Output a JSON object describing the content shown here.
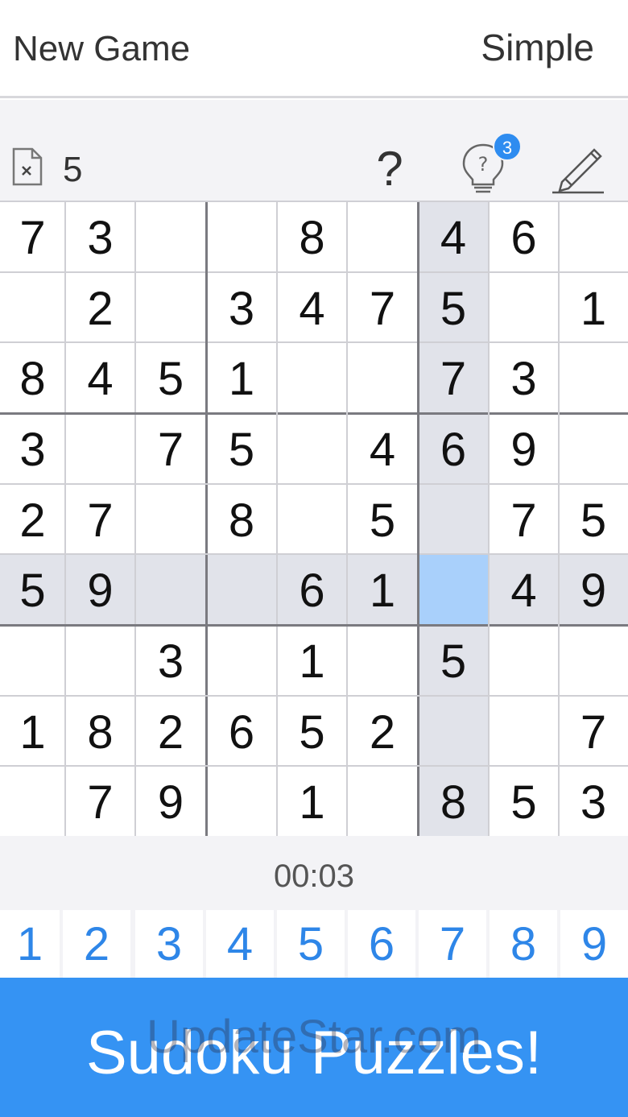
{
  "header": {
    "new_game_label": "New Game",
    "difficulty_label": "Simple"
  },
  "toolbar": {
    "mistakes_icon": "file-x-icon",
    "mistakes_count": "5",
    "help_label": "?",
    "hint_icon": "lightbulb-icon",
    "hint_badge": "3",
    "pencil_icon": "pencil-icon"
  },
  "board": {
    "rows": [
      [
        "7",
        "3",
        "",
        "",
        "8",
        "",
        "4",
        "6",
        ""
      ],
      [
        "",
        "2",
        "",
        "3",
        "4",
        "7",
        "5",
        "",
        "1"
      ],
      [
        "8",
        "4",
        "5",
        "1",
        "",
        "",
        "7",
        "3",
        ""
      ],
      [
        "3",
        "",
        "7",
        "5",
        "",
        "4",
        "6",
        "9",
        ""
      ],
      [
        "2",
        "7",
        "",
        "8",
        "",
        "5",
        "",
        "7",
        "5"
      ],
      [
        "5",
        "9",
        "",
        "",
        "6",
        "1",
        "",
        "4",
        "9"
      ],
      [
        "",
        "",
        "3",
        "",
        "1",
        "",
        "5",
        "",
        ""
      ],
      [
        "1",
        "8",
        "2",
        "6",
        "5",
        "2",
        "",
        "",
        "7"
      ],
      [
        "",
        "7",
        "9",
        "",
        "1",
        "",
        "8",
        "5",
        "3"
      ]
    ],
    "selected": {
      "row": 5,
      "col": 6
    },
    "colors": {
      "selected": "#a9d0fb",
      "highlight": "#e1e3ea",
      "digit": "#111111"
    }
  },
  "timer": "00:03",
  "numpad": {
    "keys": [
      "1",
      "2",
      "3",
      "4",
      "5",
      "6",
      "7",
      "8",
      "9"
    ],
    "color": "#2e86e8"
  },
  "banner": {
    "text": "Sudoku Puzzles!",
    "watermark": "UpdateStar.com",
    "color": "#3593f3"
  }
}
